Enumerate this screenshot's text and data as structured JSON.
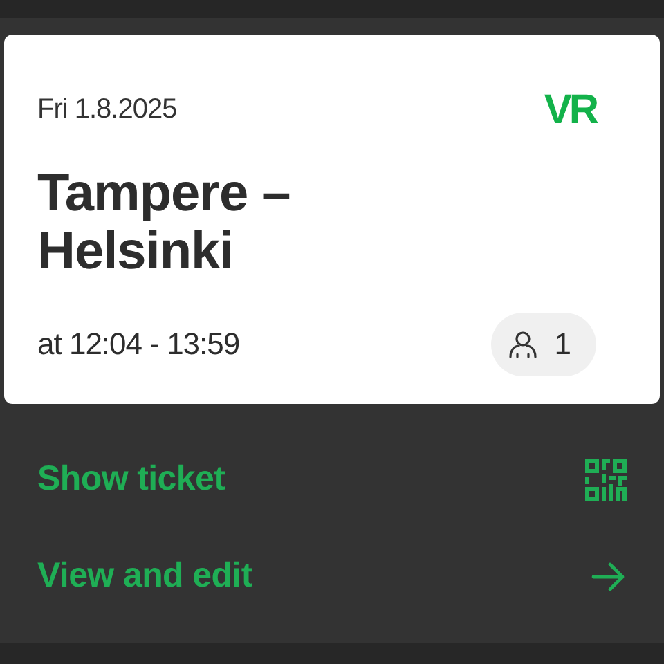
{
  "ticket": {
    "date": "Fri 1.8.2025",
    "logo": "VR",
    "route": [
      "Tampere –",
      "Helsinki"
    ],
    "time": "at 12:04 - 13:59",
    "passengers": "1"
  },
  "actions": [
    {
      "label": "Show ticket",
      "kind": "qr"
    },
    {
      "label": "View and edit",
      "kind": "arrow"
    }
  ]
}
